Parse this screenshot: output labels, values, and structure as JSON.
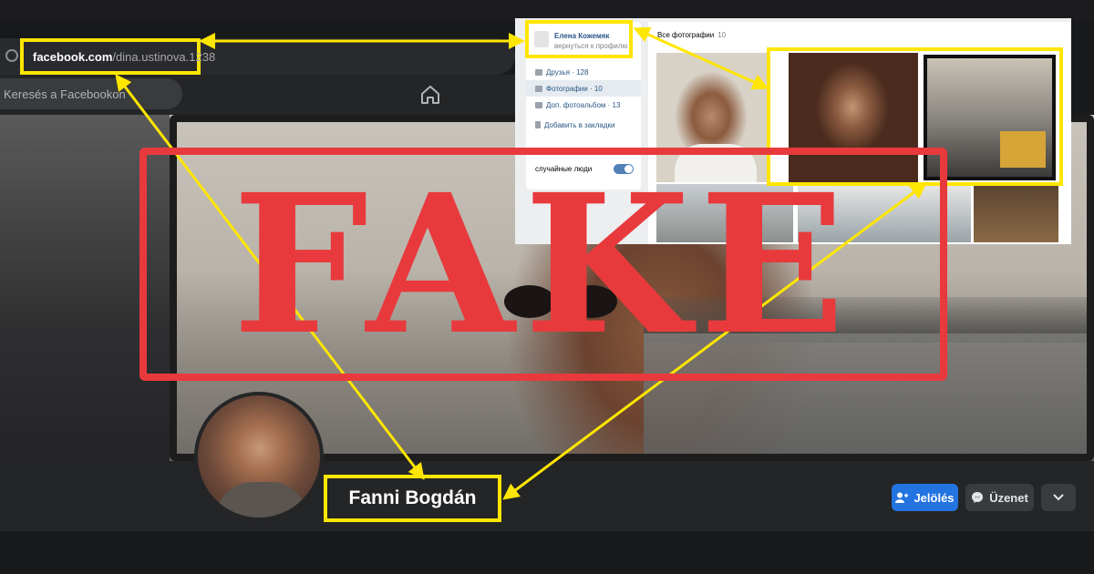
{
  "browser": {
    "url_host": "facebook.com",
    "url_path": "/dina.ustinova.1238"
  },
  "facebook": {
    "search_placeholder": "Keresés a Facebookon",
    "profile_name": "Fanni Bogdán",
    "buttons": {
      "tag": "Jelölés",
      "message": "Üzenet"
    },
    "accent_color": "#2374e1"
  },
  "vk": {
    "profile_name": "Елена Кожемяк",
    "back_link": "вернуться к профилю",
    "nav": [
      {
        "label": "Друзья · 128",
        "icon": "friends-icon"
      },
      {
        "label": "Фотографии · 10",
        "icon": "camera-icon"
      },
      {
        "label": "Доп. фотоальбом · 13",
        "icon": "camera-icon"
      },
      {
        "label": "Добавить в закладки",
        "icon": "bookmark-icon"
      }
    ],
    "toggle_label": "случайные люди",
    "all_photos_label": "Все фотографии",
    "all_photos_count": "10"
  },
  "overlay": {
    "stamp_text": "FAKE",
    "stamp_color": "#e83a3d",
    "highlight_color": "#ffe600"
  }
}
